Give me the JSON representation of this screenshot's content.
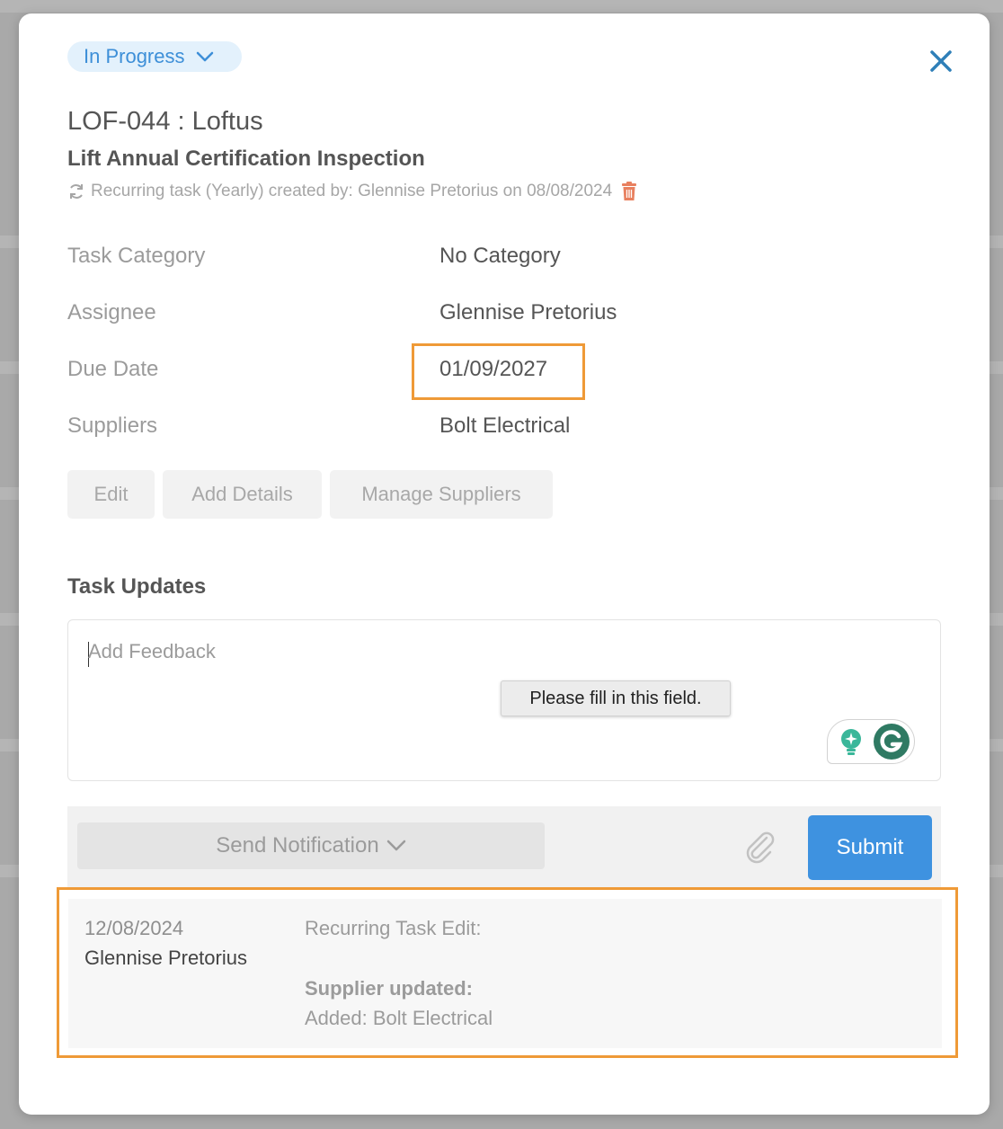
{
  "status": {
    "label": "In Progress"
  },
  "task": {
    "code_title": "LOF-044 : Loftus",
    "name": "Lift Annual Certification Inspection",
    "recurring_text": "Recurring task (Yearly) created by: Glennise Pretorius on 08/08/2024"
  },
  "fields": {
    "category_label": "Task Category",
    "category_value": "No Category",
    "assignee_label": "Assignee",
    "assignee_value": "Glennise Pretorius",
    "due_label": "Due Date",
    "due_value": "01/09/2027",
    "suppliers_label": "Suppliers",
    "suppliers_value": "Bolt Electrical"
  },
  "actions": {
    "edit": "Edit",
    "add_details": "Add Details",
    "manage_suppliers": "Manage Suppliers"
  },
  "updates": {
    "title": "Task Updates",
    "placeholder": "Add Feedback",
    "validation_tooltip": "Please fill in this field.",
    "send_notification": "Send Notification",
    "submit": "Submit",
    "entries": [
      {
        "date": "12/08/2024",
        "user": "Glennise Pretorius",
        "kind": "Recurring Task Edit:",
        "heading": "Supplier updated:",
        "detail": "Added: Bolt Electrical"
      }
    ]
  },
  "colors": {
    "accent": "#3e92e0",
    "highlight": "#ef9a37",
    "status_bg": "#e3f1fc",
    "trash": "#e8805f"
  },
  "icons": [
    "chevron-down-icon",
    "close-icon",
    "refresh-icon",
    "trash-icon",
    "lightbulb-icon",
    "grammarly-icon",
    "paperclip-icon"
  ]
}
